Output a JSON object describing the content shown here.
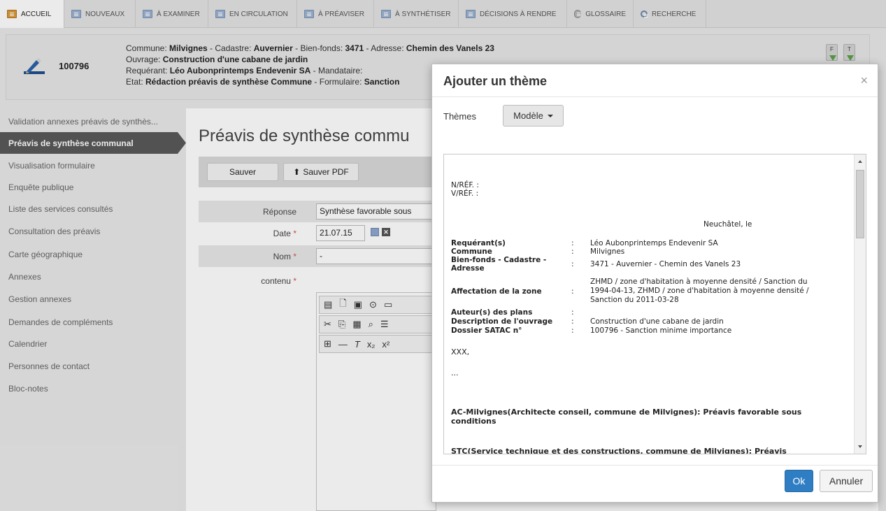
{
  "nav": {
    "tabs": [
      {
        "label": "ACCUEIL",
        "icon": "home-icon"
      },
      {
        "label": "NOUVEAUX",
        "icon": "list-icon"
      },
      {
        "label": "À EXAMINER",
        "icon": "list-icon"
      },
      {
        "label": "EN CIRCULATION",
        "icon": "list-icon"
      },
      {
        "label": "À PRÉAVISER",
        "icon": "list-icon"
      },
      {
        "label": "À SYNTHÉTISER",
        "icon": "list-icon"
      },
      {
        "label": "DÉCISIONS À RENDRE",
        "icon": "list-icon"
      },
      {
        "label": "GLOSSAIRE",
        "icon": "glossary-icon"
      },
      {
        "label": "RECHERCHE",
        "icon": "search-icon"
      }
    ]
  },
  "header": {
    "dossier_id": "100796",
    "line1": {
      "l1": "Commune: ",
      "v1": "Milvignes",
      "l2": " - Cadastre: ",
      "v2": "Auvernier",
      "l3": " - Bien-fonds: ",
      "v3": "3471",
      "l4": " - Adresse: ",
      "v4": "Chemin des Vanels 23"
    },
    "line2": {
      "l1": "Ouvrage: ",
      "v1": "Construction d'une cabane de jardin"
    },
    "line3": {
      "l1": "Requérant: ",
      "v1": "Léo Aubonprintemps Endevenir SA",
      "l2": " - Mandataire:"
    },
    "line4": {
      "l1": "Etat: ",
      "v1": "Rédaction préavis de synthèse Commune",
      "l2": " - Formulaire: ",
      "v2": "Sanction"
    },
    "buttons": [
      "F",
      "T"
    ]
  },
  "sidebar": {
    "items": [
      "Validation annexes préavis de synthès...",
      "Préavis de synthèse communal",
      "Visualisation formulaire",
      "Enquête publique",
      "Liste des services consultés",
      "Consultation des préavis",
      "Carte géographique",
      "Annexes",
      "Gestion annexes",
      "Demandes de compléments",
      "Calendrier",
      "Personnes de contact",
      "Bloc-notes"
    ],
    "active_index": 1
  },
  "main": {
    "title": "Préavis de synthèse commu",
    "save_label": "Sauver",
    "save_pdf_label": "Sauver PDF",
    "form": {
      "reponse_label": "Réponse",
      "reponse_value": "Synthèse favorable sous",
      "date_label": "Date",
      "date_value": "21.07.15",
      "nom_label": "Nom",
      "nom_value": "-",
      "contenu_label": "contenu",
      "required_mark": "*"
    }
  },
  "modal": {
    "title": "Ajouter un thème",
    "close": "×",
    "themes_label": "Thèmes",
    "model_button": "Modèle",
    "ok": "Ok",
    "cancel": "Annuler",
    "doc": {
      "nref": "N/RÉF. :",
      "vref": "V/RÉF. :",
      "place_date": "Neuchâtel, le",
      "colon": ":",
      "fields": {
        "requerant_k": "Requérant(s)",
        "requerant_v": "Léo Aubonprintemps Endevenir SA",
        "commune_k": "Commune",
        "commune_v": "Milvignes",
        "bienfonds_k1": "Bien-fonds - Cadastre -",
        "bienfonds_k2": "Adresse",
        "bienfonds_v": "3471 - Auvernier - Chemin des Vanels 23",
        "affectation_k": "Affectation de la zone",
        "affectation_v1": "ZHMD / zone d'habitation à moyenne densité / Sanction du",
        "affectation_v2": "1994-04-13, ZHMD / zone d'habitation à moyenne densité /",
        "affectation_v3": "Sanction du 2011-03-28",
        "auteurs_k": "Auteur(s) des plans",
        "description_k": "Description de l'ouvrage",
        "description_v": "Construction d'une cabane de jardin",
        "satac_k": "Dossier SATAC n°",
        "satac_v": "100796 - Sanction minime importance"
      },
      "xxx": "XXX,",
      "ellipsis": "...",
      "ac1": "AC-Milvignes(Architecte conseil, commune de Milvignes): Préavis favorable sous",
      "ac2": "conditions",
      "stc": "STC(Service technique et des constructions, commune de Milvignes): Préavis"
    }
  }
}
